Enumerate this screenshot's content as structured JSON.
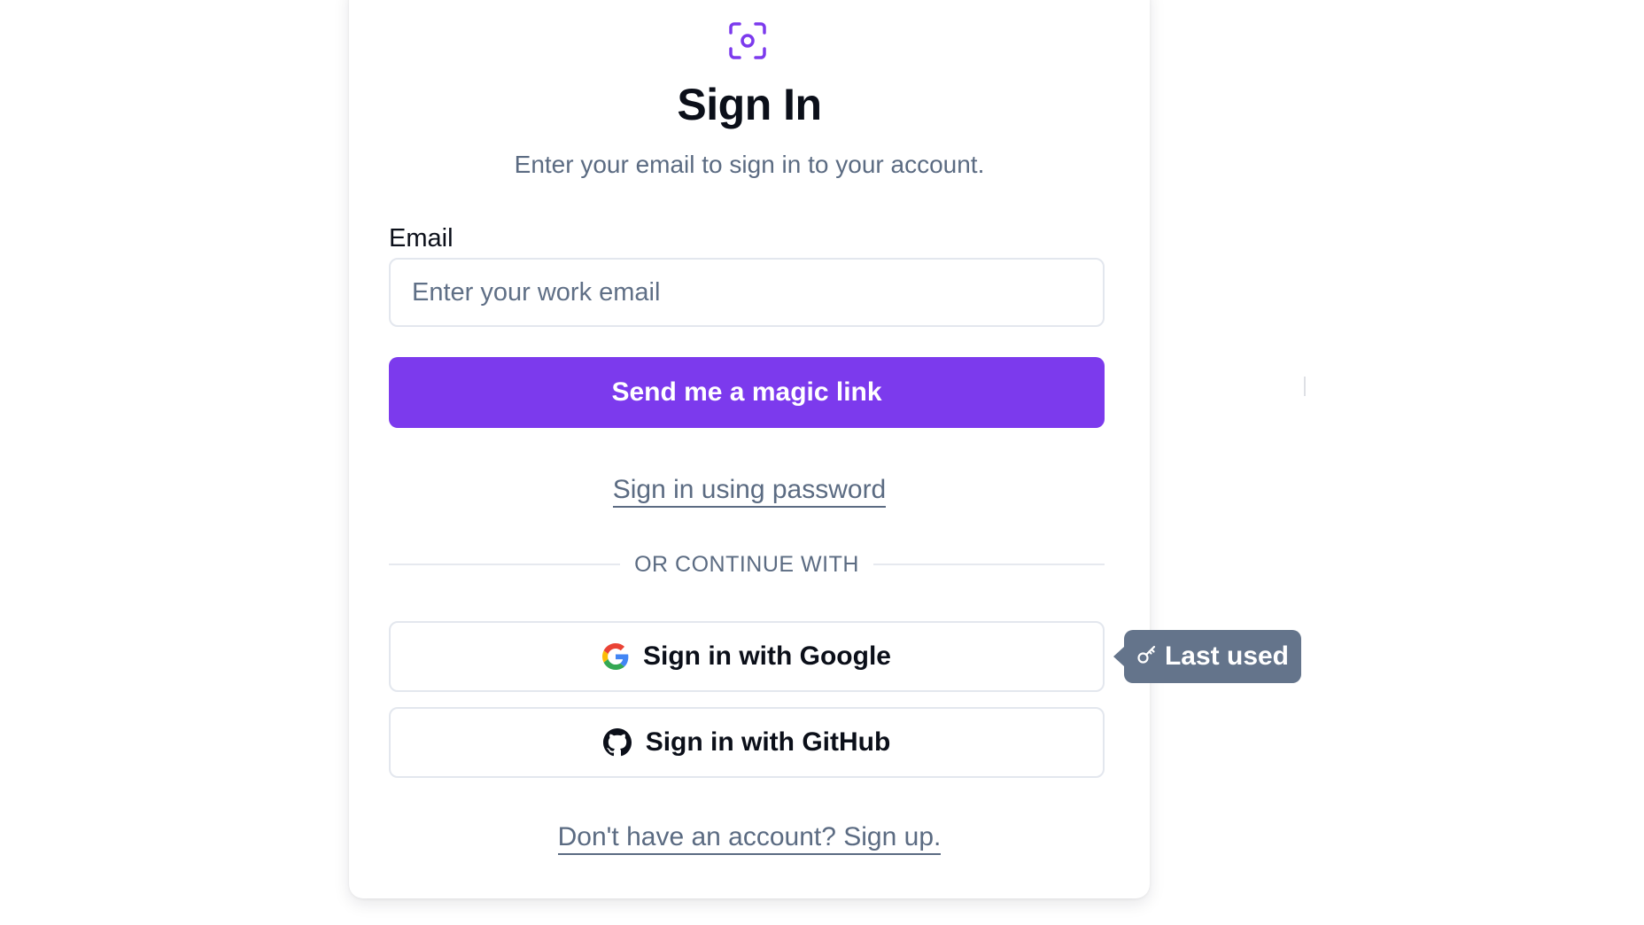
{
  "header": {
    "logo_icon": "scan-focus-icon",
    "title": "Sign In",
    "subtitle": "Enter your email to sign in to your account."
  },
  "email": {
    "label": "Email",
    "placeholder": "Enter your work email",
    "value": ""
  },
  "magic_link_button": "Send me a magic link",
  "password_link": "Sign in using password",
  "divider_text": "OR CONTINUE WITH",
  "oauth": [
    {
      "label": "Sign in with Google",
      "icon": "google-icon"
    },
    {
      "label": "Sign in with GitHub",
      "icon": "github-icon"
    }
  ],
  "last_used_badge": {
    "label": "Last used",
    "icon": "key-icon"
  },
  "signup_link": "Don't have an account? Sign up.",
  "colors": {
    "accent": "#7c3aed",
    "badge_bg": "#64748b",
    "muted_text": "#5b6b82",
    "heading_text": "#0b0f19",
    "border": "#e3e7ee"
  }
}
